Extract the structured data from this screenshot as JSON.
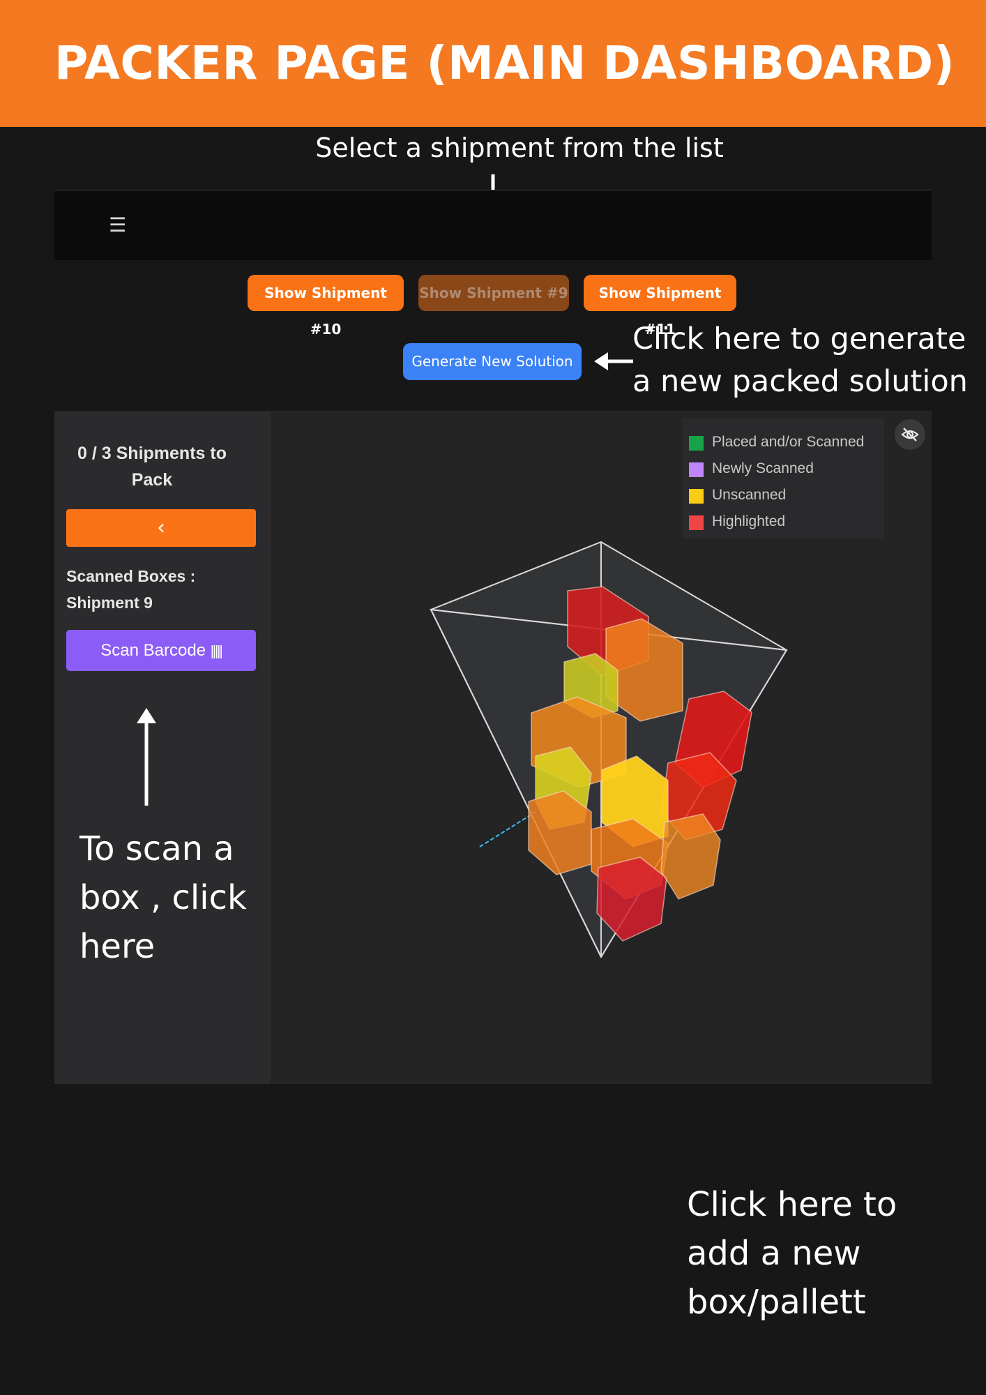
{
  "banner": {
    "title": "PACKER PAGE (MAIN DASHBOARD)",
    "color": "#f47920"
  },
  "notes": {
    "select_shipment": "Select a shipment from the list",
    "generate": "Click here to generate\na new packed solution",
    "scan": "To scan a\nbox , click\nhere",
    "add_box": "Click here to\nadd a new\nbox/pallett"
  },
  "navbar": {
    "menu_icon": "hamburger-menu-icon"
  },
  "shipments": [
    {
      "label": "Show Shipment #10",
      "active": false
    },
    {
      "label": "Show Shipment #9",
      "active": true
    },
    {
      "label": "Show Shipment #11",
      "active": false
    }
  ],
  "generate_button": {
    "label": "Generate New Solution",
    "color": "#3b82f6"
  },
  "sidebar": {
    "title": "0 / 3 Shipments to Pack",
    "back_icon": "chevron-left-icon",
    "scanned_label": "Scanned Boxes : Shipment 9",
    "scan_button": "Scan Barcode",
    "scan_icon": "barcode-icon"
  },
  "legend": {
    "items": [
      {
        "label": "Placed and/or Scanned",
        "color": "#16a34a"
      },
      {
        "label": "Newly Scanned",
        "color": "#c084fc"
      },
      {
        "label": "Unscanned",
        "color": "#facc15"
      },
      {
        "label": "Highlighted",
        "color": "#ef4444"
      }
    ],
    "toggle_icon": "eye-off-icon"
  },
  "colors": {
    "accent": "#f97316",
    "purple": "#8b5cf6",
    "background": "#171717"
  }
}
